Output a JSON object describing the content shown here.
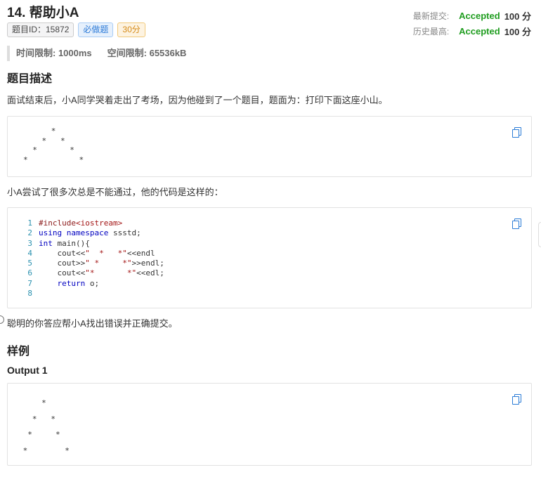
{
  "problem": {
    "title": "14.  帮助小A",
    "tags": [
      "题目ID：15872",
      "必做题",
      "30分"
    ]
  },
  "stats": {
    "latest_label": "最新提交:",
    "latest_status": "Accepted",
    "latest_score": "100 分",
    "best_label": "历史最高:",
    "best_status": "Accepted",
    "best_score": "100 分"
  },
  "limits": {
    "time": "时间限制: 1000ms",
    "memory": "空间限制: 65536kB"
  },
  "description": {
    "heading": "题目描述",
    "intro": "面试结束后，小A同学哭着走出了考场，因为他碰到了一个题目，题面为：打印下面这座小山。",
    "mountain": "      *\n    *   *\n  *       *\n*           *",
    "middle": "小A尝试了很多次总是不能通过，他的代码是这样的：",
    "code_lines": [
      {
        "num": "1",
        "text": "#include<iostream>"
      },
      {
        "num": "2",
        "text": "using namespace ssstd;"
      },
      {
        "num": "3",
        "text": "int main(){"
      },
      {
        "num": "4",
        "text": "    cout<<\"  *   *\"<<endl"
      },
      {
        "num": "5",
        "text": "    cout>>\" *     *\">>endl;"
      },
      {
        "num": "6",
        "text": "    cout<<\"*       *\"<<edl;"
      },
      {
        "num": "7",
        "text": "    return o;"
      },
      {
        "num": "8",
        "text": ""
      }
    ],
    "outro": "聪明的你答应帮小A找出错误并正确提交。"
  },
  "sample": {
    "heading": "样例",
    "output_label": "Output 1",
    "output_text": "     *\n   *   *\n  *     *\n *        *"
  },
  "colors": {
    "accepted": "#1f9d1f",
    "copy_icon": "#2a7bd6",
    "line_number": "#2b91af"
  }
}
